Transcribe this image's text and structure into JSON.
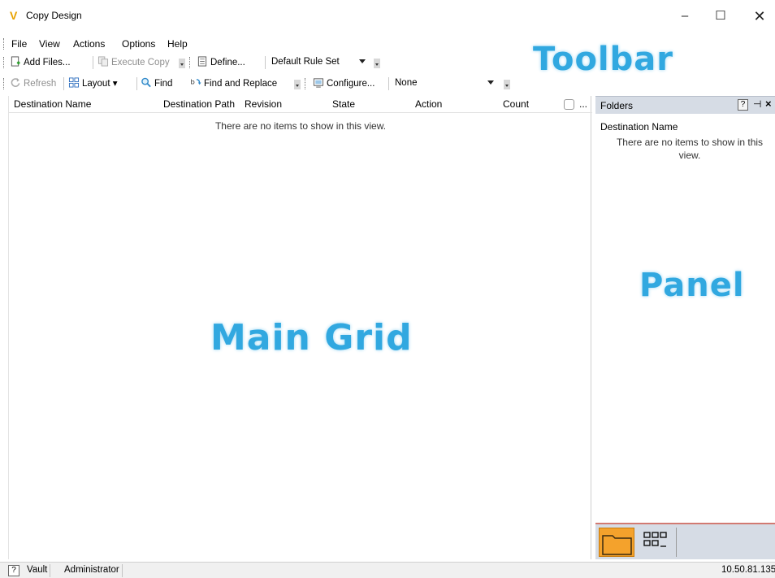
{
  "window": {
    "title": "Copy Design",
    "logo": "V",
    "minimize": "–",
    "maximize": "☐",
    "close": "✕"
  },
  "menu": [
    "File",
    "View",
    "Actions",
    "Options",
    "Help"
  ],
  "toolbar1": {
    "add_files": "Add Files...",
    "execute_copy": "Execute Copy",
    "define": "Define...",
    "rule_set": "Default Rule Set"
  },
  "toolbar2": {
    "refresh": "Refresh",
    "layout": "Layout",
    "find": "Find",
    "find_replace": "Find and Replace",
    "configure": "Configure...",
    "filter": "None"
  },
  "labels": {
    "toolbar": "Toolbar",
    "main_grid": "Main Grid",
    "panel": "Panel"
  },
  "grid": {
    "columns": [
      "Destination Name",
      "Destination Path",
      "Revision",
      "State",
      "Action",
      "Count",
      "..."
    ],
    "empty_text": "There are no items to show in this view."
  },
  "panel": {
    "title": "Folders",
    "help": "?",
    "pin": "⊣",
    "close": "×",
    "column": "Destination Name",
    "empty_text": "There are no items to show in this view."
  },
  "status": {
    "help": "?",
    "vault": "Vault",
    "user": "Administrator",
    "ip": "10.50.81.135"
  },
  "icons": [
    "app-logo-icon",
    "add-files-icon",
    "execute-copy-icon",
    "define-icon",
    "refresh-icon",
    "layout-icon",
    "find-icon",
    "find-replace-icon",
    "configure-icon",
    "folder-icon",
    "grid-view-icon"
  ],
  "colors": {
    "accent": "#31a8e0",
    "panel_header": "#d6dce5",
    "folder": "#f4a22c"
  }
}
